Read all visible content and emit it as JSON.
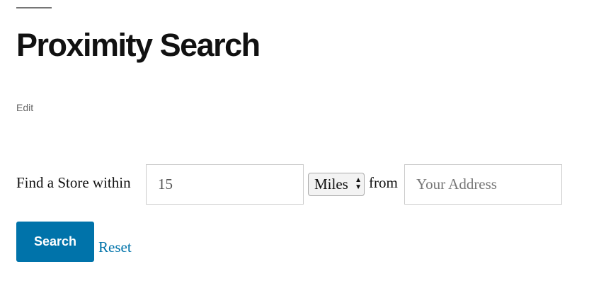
{
  "page": {
    "title": "Proximity Search",
    "edit_link": "Edit"
  },
  "form": {
    "label_prefix": "Find a Store within",
    "distance_value": "15",
    "unit_selected": "Miles",
    "label_from": "from",
    "address_placeholder": "Your Address",
    "search_label": "Search",
    "reset_label": "Reset"
  },
  "colors": {
    "accent": "#0073aa"
  }
}
